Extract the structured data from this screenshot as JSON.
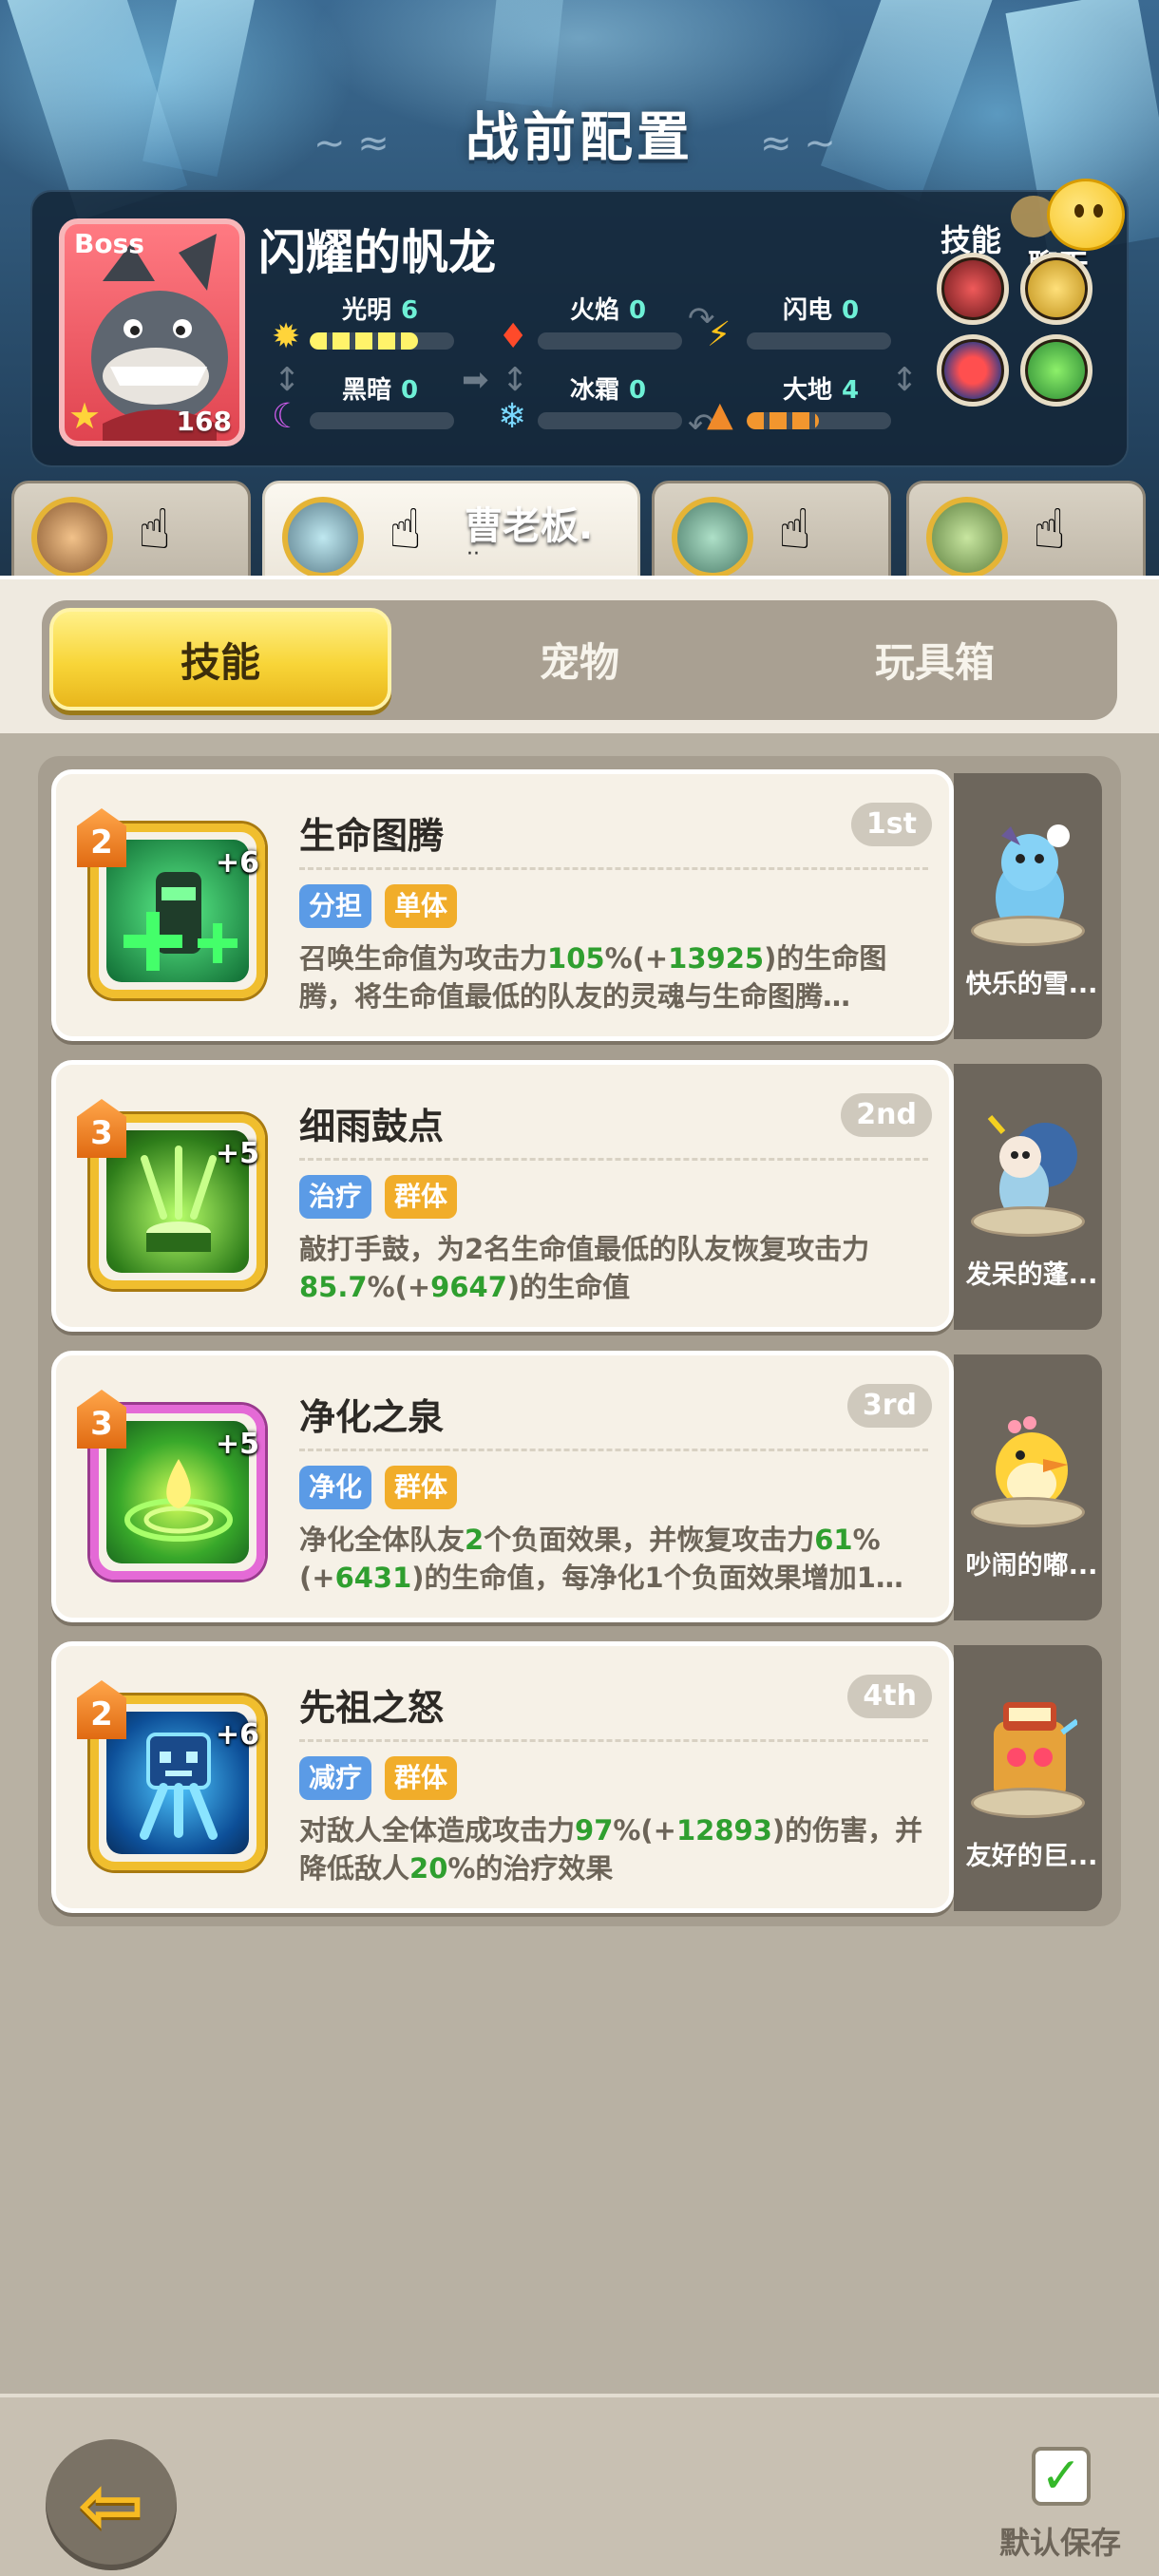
{
  "header": {
    "title": "战前配置",
    "boss": {
      "tag": "Boss",
      "name": "闪耀的帆龙",
      "level": "168",
      "elements": [
        {
          "name": "光明",
          "value": "6",
          "level": 6
        },
        {
          "name": "火焰",
          "value": "0",
          "level": 0
        },
        {
          "name": "闪电",
          "value": "0",
          "level": 0
        },
        {
          "name": "黑暗",
          "value": "0",
          "level": 0
        },
        {
          "name": "冰霜",
          "value": "0",
          "level": 0
        },
        {
          "name": "大地",
          "value": "4",
          "level": 4
        }
      ],
      "skills_label": "技能",
      "chat_label": "聊天"
    },
    "team_tabs": [
      {
        "name": "",
        "active": false
      },
      {
        "name": "曹老板.",
        "dots": "··",
        "active": true
      },
      {
        "name": "",
        "active": false
      },
      {
        "name": "",
        "active": false
      }
    ]
  },
  "categories": [
    "技能",
    "宠物",
    "玩具箱"
  ],
  "skills": [
    {
      "badge": "2",
      "plus": "+6",
      "title": "生命图腾",
      "rank": "1st",
      "tags": [
        "分担",
        "单体"
      ],
      "desc": [
        "召唤生命值为攻击力",
        "105",
        "%(+",
        "13925",
        ")的生命图腾，将生命值最低的队友的灵魂与生命图腾…"
      ],
      "pet": "快乐的雪..."
    },
    {
      "badge": "3",
      "plus": "+5",
      "title": "细雨鼓点",
      "rank": "2nd",
      "tags": [
        "治疗",
        "群体"
      ],
      "desc": [
        "敲打手鼓，为2名生命值最低的队友恢复攻击力",
        "85.7",
        "%(+",
        "9647",
        ")的生命值"
      ],
      "pet": "发呆的蓬..."
    },
    {
      "badge": "3",
      "plus": "+5",
      "title": "净化之泉",
      "rank": "3rd",
      "tags": [
        "净化",
        "群体"
      ],
      "desc": [
        "净化全体队友",
        "2",
        "个负面效果，并恢复攻击力",
        "61",
        "%(+",
        "6431",
        ")的生命值，每净化1个负面效果增加1…"
      ],
      "pet": "吵闹的嘟..."
    },
    {
      "badge": "2",
      "plus": "+6",
      "title": "先祖之怒",
      "rank": "4th",
      "tags": [
        "减疗",
        "群体"
      ],
      "desc": [
        "对敌人全体造成攻击力",
        "97",
        "%(+",
        "12893",
        ")的伤害，并降低敌人",
        "20",
        "%的治疗效果"
      ],
      "pet": "友好的巨..."
    }
  ],
  "footer": {
    "save_label": "默认保存"
  },
  "colors": {
    "accent": "#f8d538",
    "green_value": "#2f9f2f",
    "tag_blue": "#5b9be6",
    "tag_orange": "#f1ad2a"
  }
}
